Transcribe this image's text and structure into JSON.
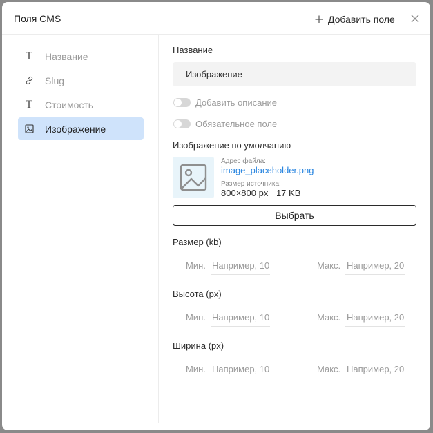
{
  "dialog": {
    "title": "Поля CMS",
    "add_field_label": "Добавить поле"
  },
  "sidebar": {
    "items": [
      {
        "label": "Название",
        "icon": "text-icon"
      },
      {
        "label": "Slug",
        "icon": "link-icon"
      },
      {
        "label": "Стоимость",
        "icon": "text-icon"
      },
      {
        "label": "Изображение",
        "icon": "image-icon",
        "active": true
      }
    ]
  },
  "form": {
    "name_label": "Название",
    "name_value": "Изображение",
    "toggle_description": "Добавить описание",
    "toggle_required": "Обязательное поле",
    "default_image_label": "Изображение по умолчанию",
    "file_address_label": "Адрес файла:",
    "file_name": "image_placeholder.png",
    "source_size_label": "Размер источника:",
    "source_dimensions": "800×800 px",
    "source_filesize": "17 KB",
    "choose_button": "Выбрать",
    "ranges": [
      {
        "label": "Размер (kb)",
        "min_label": "Мин.",
        "min_placeholder": "Например, 10",
        "max_label": "Макс.",
        "max_placeholder": "Например, 20"
      },
      {
        "label": "Высота (px)",
        "min_label": "Мин.",
        "min_placeholder": "Например, 10",
        "max_label": "Макс.",
        "max_placeholder": "Например, 20"
      },
      {
        "label": "Ширина (px)",
        "min_label": "Мин.",
        "min_placeholder": "Например, 10",
        "max_label": "Макс.",
        "max_placeholder": "Например, 20"
      }
    ]
  },
  "colors": {
    "accent": "#2a86e0",
    "active_bg": "#cfe3fb",
    "thumb_bg": "#e8f4fa"
  }
}
